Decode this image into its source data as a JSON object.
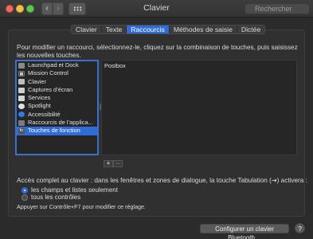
{
  "window": {
    "title": "Clavier",
    "back": "‹",
    "forward": "›",
    "search_placeholder": "Rechercher"
  },
  "tabs": [
    {
      "label": "Clavier"
    },
    {
      "label": "Texte"
    },
    {
      "label": "Raccourcis",
      "active": true
    },
    {
      "label": "Méthodes de saisie"
    },
    {
      "label": "Dictée"
    }
  ],
  "instructions": "Pour modifier un raccourci, sélectionnez-le, cliquez sur la combinaison de touches, puis saisissez les nouvelles touches.",
  "categories": [
    {
      "label": "Launchpad et Dock",
      "icon": "launchpad-icon"
    },
    {
      "label": "Mission Control",
      "icon": "mission-control-icon",
      "glyph": "▦"
    },
    {
      "label": "Clavier",
      "icon": "keyboard-icon"
    },
    {
      "label": "Captures d’écran",
      "icon": "screenshot-icon"
    },
    {
      "label": "Services",
      "icon": "services-icon"
    },
    {
      "label": "Spotlight",
      "icon": "spotlight-icon"
    },
    {
      "label": "Accessibilité",
      "icon": "accessibility-icon"
    },
    {
      "label": "Raccourcis de l’applica...",
      "icon": "app-shortcuts-icon"
    },
    {
      "label": "Touches de fonction",
      "icon": "fn-key-icon",
      "glyph": "fn",
      "selected": true
    }
  ],
  "shortcuts": [
    "Postbox"
  ],
  "buttons": {
    "add": "+",
    "remove": "−",
    "bluetooth": "Configurer un clavier Bluetooth…",
    "help": "?"
  },
  "full_access": {
    "label": "Accès complet au clavier : dans les fenêtres et zones de dialogue, la touche Tabulation (⇥) activera :",
    "options": [
      {
        "label": "les champs et listes seulement",
        "selected": true
      },
      {
        "label": "tous les contrôles",
        "selected": false
      }
    ],
    "hint": "Appuyer sur Contrôle+F7 pour modifier ce réglage."
  },
  "colors": {
    "accent": "#2f6cd6",
    "background": "#2b2b2b"
  }
}
